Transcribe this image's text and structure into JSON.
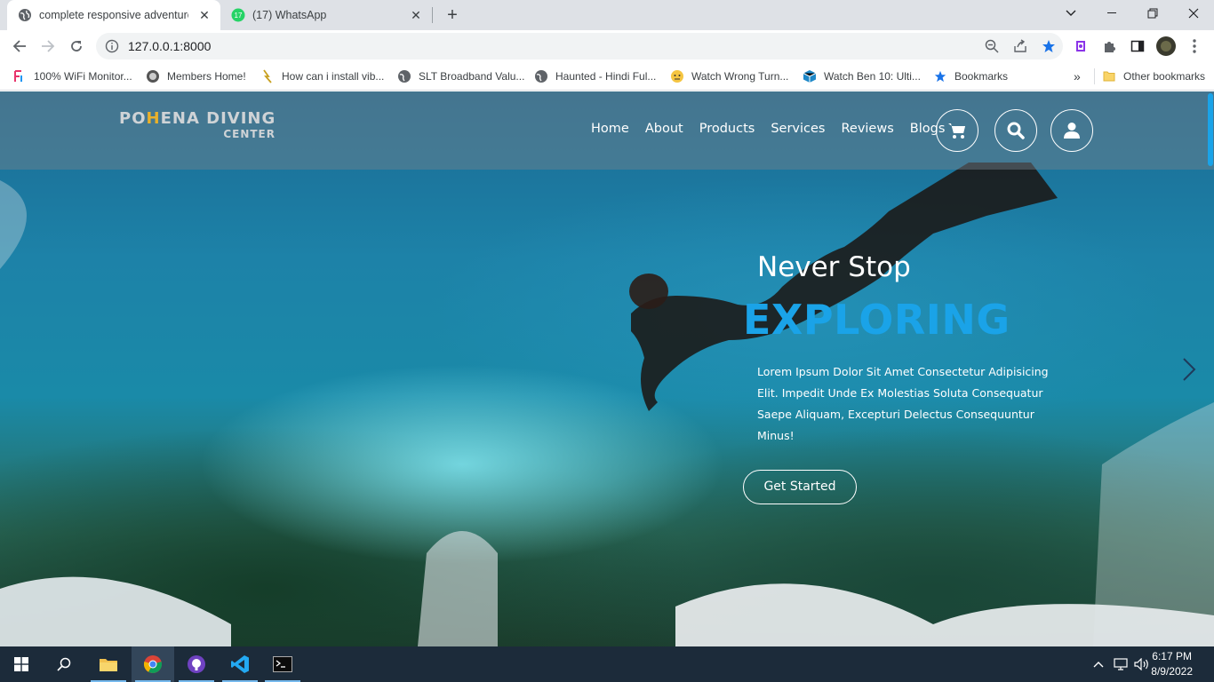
{
  "browser": {
    "tabs": [
      {
        "title": "complete responsive adventure &",
        "active": true
      },
      {
        "title": "(17) WhatsApp",
        "active": false,
        "badge": "17"
      }
    ],
    "url": "127.0.0.1:8000",
    "bookmarks": [
      {
        "label": "100% WiFi Monitor..."
      },
      {
        "label": "Members Home!"
      },
      {
        "label": "How can i install vib..."
      },
      {
        "label": "SLT Broadband Valu..."
      },
      {
        "label": "Haunted - Hindi Ful..."
      },
      {
        "label": "Watch Wrong Turn..."
      },
      {
        "label": "Watch Ben 10: Ulti..."
      },
      {
        "label": "Bookmarks"
      }
    ],
    "more_bookmarks": "»",
    "other_bookmarks": "Other bookmarks"
  },
  "site": {
    "logo_line1_a": "PO",
    "logo_line1_accent": "H",
    "logo_line1_b": "ENA DIVING",
    "logo_line2": "CENTER",
    "nav": [
      "Home",
      "About",
      "Products",
      "Services",
      "Reviews",
      "Blogs"
    ],
    "hero_small": "Never Stop",
    "hero_big": "EXPLORING",
    "hero_text": "Lorem Ipsum Dolor Sit Amet Consectetur Adipisicing Elit. Impedit Unde Ex Molestias Soluta Consequatur Saepe Aliquam, Excepturi Delectus Consequuntur Minus!",
    "cta": "Get Started",
    "accent_color": "#1aa3e8"
  },
  "taskbar": {
    "time": "6:17 PM",
    "date": "8/9/2022"
  }
}
